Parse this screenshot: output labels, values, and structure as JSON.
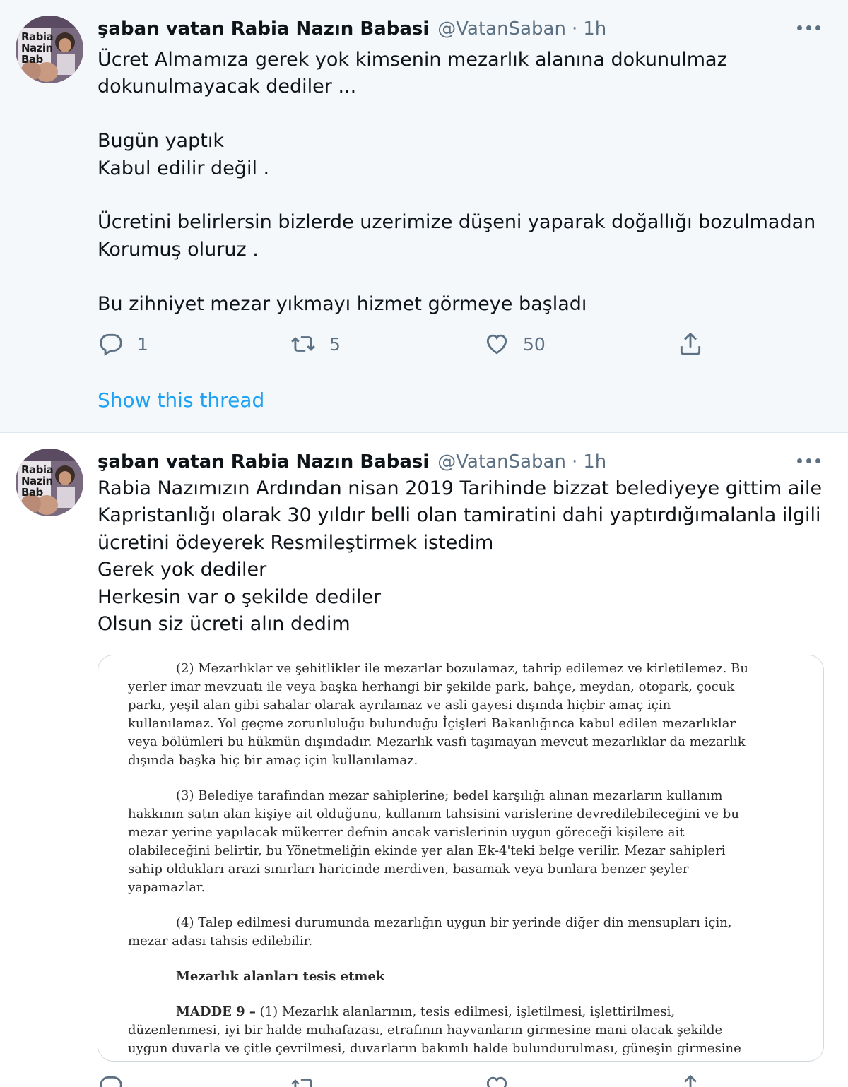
{
  "tweets": [
    {
      "author_name": "şaban vatan Rabia Nazın Babasi",
      "handle": "@VatanSaban",
      "separator": "·",
      "time": "1h",
      "avatar_text": [
        "Rabia",
        "Nazin",
        "Bab"
      ],
      "text_lines": [
        "Ücret Almamıza gerek yok kimsenin mezarlık alanına dokunulmaz",
        "dokunulmayacak dediler ...",
        "",
        "Bugün yaptık",
        "Kabul edilir değil .",
        "",
        "Ücretini belirlersin bizlerde uzerimize düşeni yaparak doğallığı bozulmadan",
        "Korumuş oluruz .",
        "",
        "Bu zihniyet mezar yıkmayı hizmet görmeye başladı"
      ],
      "reply_count": "1",
      "retweet_count": "5",
      "like_count": "50",
      "show_thread_label": "Show this thread"
    },
    {
      "author_name": "şaban vatan Rabia Nazın Babasi",
      "handle": "@VatanSaban",
      "separator": "·",
      "time": "1h",
      "avatar_text": [
        "Rabia",
        "Nazin",
        "Bab"
      ],
      "text_lines": [
        "Rabia Nazımızın Ardından nisan 2019 Tarihinde bizzat belediyeye gittim aile",
        "Kapristanlığı olarak 30 yıldır belli olan tamiratini dahi yaptırdığımalanla ilgili",
        "ücretini ödeyerek Resmileştirmek istedim",
        "Gerek yok dediler",
        "Herkesin var o şekilde dediler",
        "Olsun siz ücreti alın dedim"
      ],
      "document_lines": [
        "(2) Mezarlıklar ve şehitlikler ile mezarlar bozulamaz, tahrip edilemez ve kirletilemez. Bu",
        "yerler imar mevzuatı ile veya başka herhangi bir şekilde park, bahçe, meydan, otopark, çocuk",
        "parkı, yeşil alan gibi sahalar olarak ayrılamaz ve asli gayesi dışında hiçbir amaç için",
        "kullanılamaz. Yol geçme zorunluluğu bulunduğu İçişleri Bakanlığınca kabul edilen mezarlıklar",
        "veya bölümleri bu hükmün dışındadır. Mezarlık vasfı taşımayan mevcut mezarlıklar da mezarlık",
        "dışında başka hiç bir amaç için kullanılamaz.",
        "(3) Belediye tarafından mezar sahiplerine; bedel karşılığı alınan mezarların kullanım",
        "hakkının satın alan kişiye ait olduğunu, kullanım tahsisini varislerine devredilebileceğini ve bu",
        "mezar yerine yapılacak mükerrer defnin ancak varislerinin uygun göreceği kişilere ait",
        "olabileceğini belirtir, bu Yönetmeliğin ekinde yer alan Ek-4'teki belge verilir. Mezar sahipleri",
        "sahip oldukları arazi sınırları haricinde merdiven, basamak veya bunlara benzer şeyler",
        "yapamazlar.",
        "(4) Talep edilmesi durumunda mezarlığın uygun bir yerinde diğer din mensupları için,",
        "mezar adası tahsis edilebilir.",
        "Mezarlık alanları tesis etmek",
        "MADDE 9 –",
        "(1) Mezarlık alanlarının, tesis edilmesi, işletilmesi, işlettirilmesi,",
        "düzenlenmesi, iyi bir halde muhafazası, etrafının hayvanların girmesine mani olacak şekilde",
        "uygun duvarla ve çitle çevrilmesi, duvarların bakımlı halde bulundurulması, güneşin girmesine"
      ]
    }
  ],
  "colors": {
    "name": "#0f1419",
    "secondary": "#5b7083",
    "link": "#1da1f2",
    "highlight_bg": "#f5f8fa"
  },
  "icons": [
    "reply-icon",
    "retweet-icon",
    "like-icon",
    "share-icon",
    "more-icon"
  ]
}
